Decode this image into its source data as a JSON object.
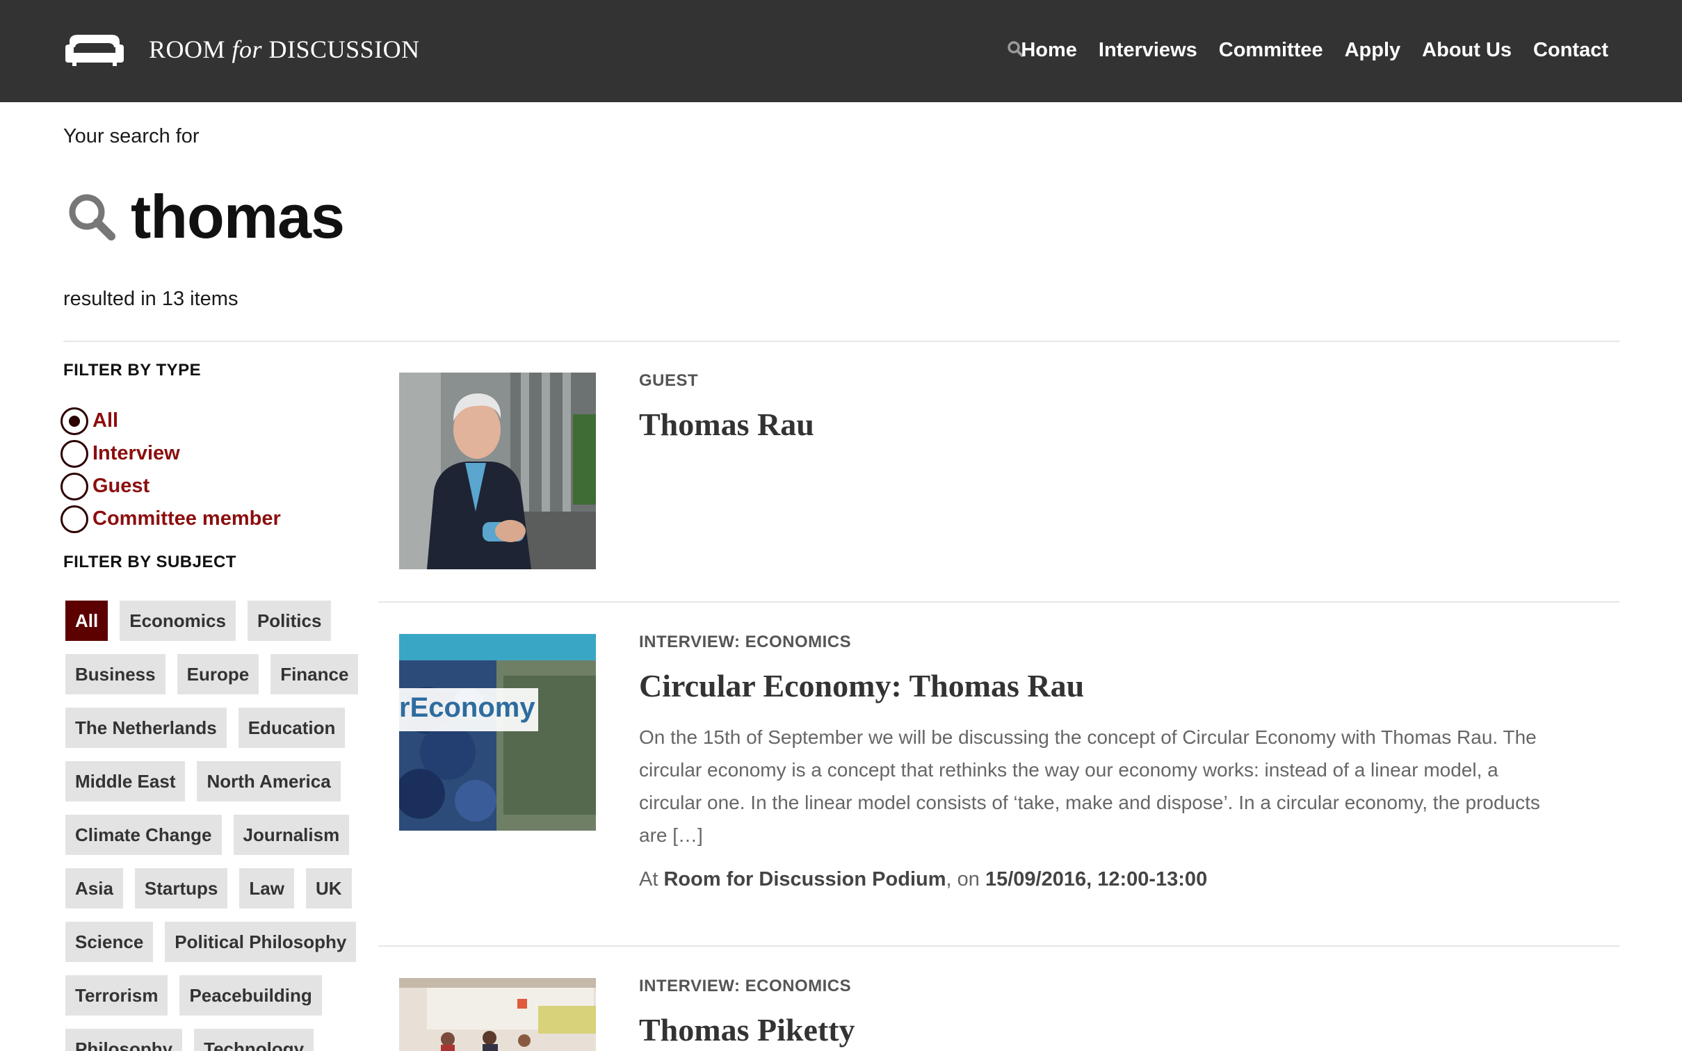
{
  "header": {
    "brand": {
      "room": "ROOM",
      "for": "for",
      "discussion": "DISCUSSION"
    },
    "search_icon": "search-icon",
    "nav": [
      {
        "label": "Home"
      },
      {
        "label": "Interviews"
      },
      {
        "label": "Committee"
      },
      {
        "label": "Apply"
      },
      {
        "label": "About Us"
      },
      {
        "label": "Contact"
      }
    ]
  },
  "search": {
    "lead": "Your search for",
    "query": "thomas",
    "result_text": "resulted in 13 items"
  },
  "sidebar": {
    "type_heading": "FILTER BY TYPE",
    "types": [
      {
        "label": "All",
        "selected": true
      },
      {
        "label": "Interview",
        "selected": false
      },
      {
        "label": "Guest",
        "selected": false
      },
      {
        "label": "Committee member",
        "selected": false
      }
    ],
    "subject_heading": "FILTER BY SUBJECT",
    "subjects": [
      {
        "label": "All",
        "active": true
      },
      {
        "label": "Economics"
      },
      {
        "label": "Politics"
      },
      {
        "label": "Business"
      },
      {
        "label": "Europe"
      },
      {
        "label": "Finance"
      },
      {
        "label": "The Netherlands"
      },
      {
        "label": "Education"
      },
      {
        "label": "Middle East"
      },
      {
        "label": "North America"
      },
      {
        "label": "Climate Change"
      },
      {
        "label": "Journalism"
      },
      {
        "label": "Asia"
      },
      {
        "label": "Startups"
      },
      {
        "label": "Law"
      },
      {
        "label": "UK"
      },
      {
        "label": "Science"
      },
      {
        "label": "Political Philosophy"
      },
      {
        "label": "Terrorism"
      },
      {
        "label": "Peacebuilding"
      },
      {
        "label": "Philosophy"
      },
      {
        "label": "Technology"
      }
    ]
  },
  "results": [
    {
      "type": "GUEST",
      "title": "Thomas Rau",
      "thumb_icon": "portrait-photo"
    },
    {
      "type": "INTERVIEW: ECONOMICS",
      "title": "Circular Economy: Thomas Rau",
      "thumb_text": "rEconomy",
      "excerpt": "On the 15th of September we will be discussing the concept of Circular Economy with Thomas Rau. The circular economy is a concept that rethinks the way our economy works: instead of a linear model, a circular one. In the linear model consists of ‘take, make and dispose’. In a circular economy, the products are […]",
      "venue_prefix": "At",
      "venue": "Room for Discussion Podium",
      "date_prefix": ", on",
      "date": "15/09/2016, 12:00-13:00"
    },
    {
      "type": "INTERVIEW: ECONOMICS",
      "title": "Thomas Piketty",
      "thumb_icon": "event-photo"
    }
  ],
  "colors": {
    "header_bg": "#333333",
    "accent": "#8b0e0e",
    "active_tag": "#5c0000",
    "tag_bg": "#e3e3e3"
  }
}
